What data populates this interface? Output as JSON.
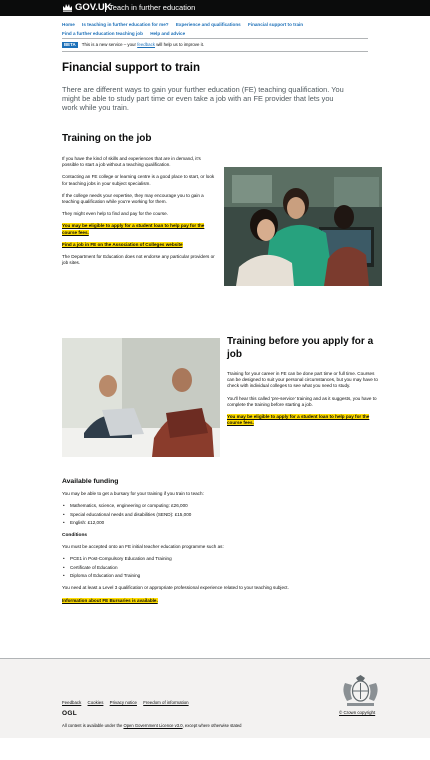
{
  "header": {
    "logo": "GOV.UK",
    "service": "Teach in further education"
  },
  "nav": {
    "items": [
      {
        "label": "Home"
      },
      {
        "label": "Is teaching in further education for me?"
      },
      {
        "label": "Experience and qualifications"
      },
      {
        "label": "Financial support to train"
      },
      {
        "label": "Find a further education teaching job"
      },
      {
        "label": "Help and advice"
      }
    ]
  },
  "beta": {
    "tag": "BETA",
    "text_before": "This is a new service – your",
    "link": "feedback",
    "text_after": "will help us to improve it."
  },
  "page": {
    "title": "Financial support to train",
    "lead": "There are different ways to gain your further education (FE) teaching qualification. You might be able to study part time or even take a job with an FE provider that lets you work while you train."
  },
  "training_on_job": {
    "heading": "Training on the job",
    "p1": "If you have the kind of skills and experiences that are in demand, it's possible to start a job without a teaching qualification.",
    "p2": "Contacting an FE college or learning centre is a good place to start, or look for teaching jobs in your subject specialism.",
    "p3": "If the college needs your expertise, they may encourage you to gain a teaching qualification while you're working for them.",
    "p4": "They might even help to find and pay for the course.",
    "link1": "You may be eligible to apply for a student loan to help pay for the course fees.",
    "link2": "Find a job in FE on the Association of Colleges website",
    "p5": "The Department for Education does not endorse any particular providers or job sites."
  },
  "training_before": {
    "heading": "Training before you apply for a job",
    "p1": "Training for your career in FE can be done part time or full time. Courses can be designed to suit your personal circumstances, but you may have to check with individual colleges to see what you need to study.",
    "p2": "You'll hear this called 'pre-service' training and as it suggests, you have to complete the training before starting a job.",
    "link": "You may be eligible to apply for a student loan to help pay for the course fees."
  },
  "funding": {
    "heading": "Available funding",
    "intro": "You may be able to get a bursary for your training if you train to teach:",
    "items": [
      "Mathematics, science, engineering or computing: £26,000",
      "Special educational needs and disabilities (SEND): £15,000",
      "English: £12,000"
    ],
    "conditions_heading": "Conditions",
    "conditions_intro": "You must be accepted onto an FE initial teacher education programme such as:",
    "conditions": [
      "PCE1 in Post-Compulsory Education and Training",
      "Certificate of Education",
      "Diploma of Education and Training"
    ],
    "requirement": "You need at least a Level 3 qualification or appropriate professional experience related to your teaching subject.",
    "link": "Information about FE Bursaries is available."
  },
  "footer": {
    "links": [
      "Feedback",
      "Cookies",
      "Privacy notice",
      "Freedom of information"
    ],
    "ogl": "OGL",
    "license_before": "All content is available under the",
    "license_link": "Open Government Licence v3.0",
    "license_after": ", except where otherwise stated",
    "copyright": "© Crown copyright"
  },
  "colors": {
    "header": "#0b0c0c",
    "link": "#1d70b8",
    "focus": "#ffdd00",
    "footer": "#f3f2f1"
  }
}
